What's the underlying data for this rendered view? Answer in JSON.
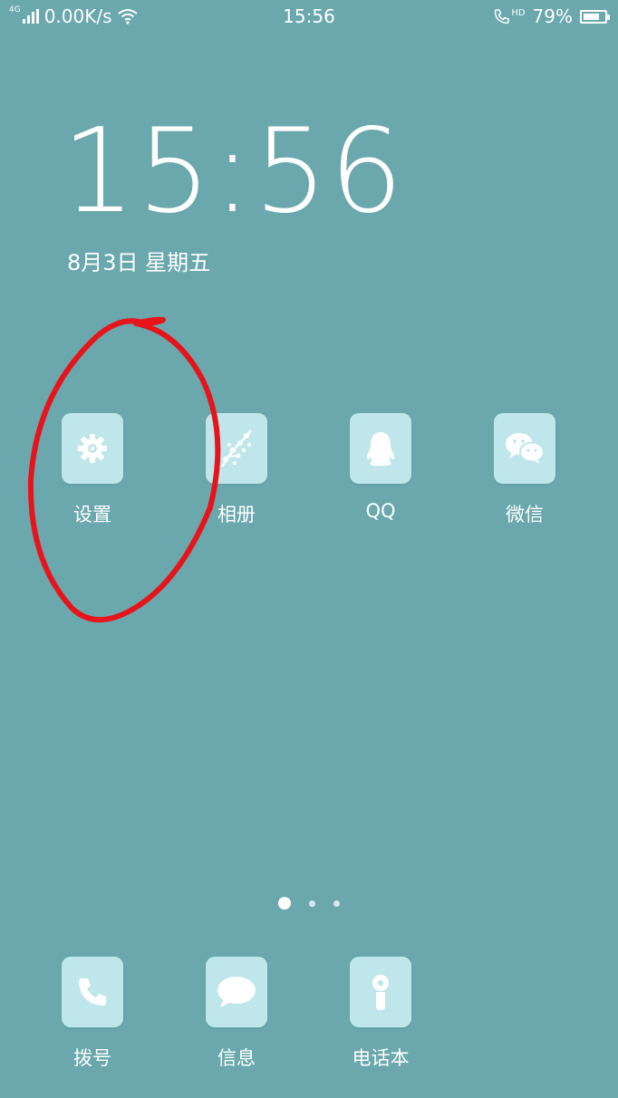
{
  "status_bar": {
    "network_type": "4G",
    "speed": "0.00K/s",
    "time": "15:56",
    "call_badge": "HD",
    "battery_percent_text": "79%",
    "battery_level": 0.79
  },
  "lock": {
    "clock": "15:56",
    "date": "8月3日  星期五"
  },
  "apps": [
    {
      "label": "设置",
      "icon": "gear-icon"
    },
    {
      "label": "相册",
      "icon": "photo-gallery-icon"
    },
    {
      "label": "QQ",
      "icon": "qq-penguin-icon"
    },
    {
      "label": "微信",
      "icon": "wechat-icon"
    }
  ],
  "dock": [
    {
      "label": "拨号",
      "icon": "phone-icon"
    },
    {
      "label": "信息",
      "icon": "message-icon"
    },
    {
      "label": "电话本",
      "icon": "contacts-icon"
    }
  ],
  "pager": {
    "pages": 3,
    "active": 0
  },
  "colors": {
    "wallpaper": "#6aa8ae",
    "icon_bg": "#bfe6ea",
    "annotation": "#e8141b"
  }
}
